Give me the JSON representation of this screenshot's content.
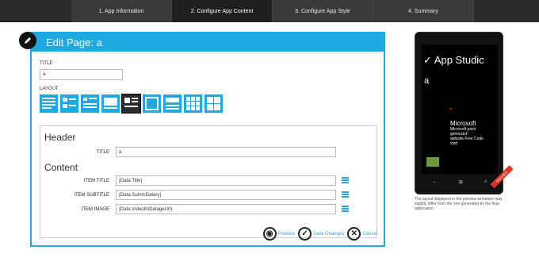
{
  "wizard": {
    "steps": [
      {
        "label": "1. App Information"
      },
      {
        "label": "2. Configure App Content"
      },
      {
        "label": "3. Configure App Style"
      },
      {
        "label": "4. Summary"
      }
    ]
  },
  "panel": {
    "title": "Edit Page: a",
    "title_label": "TITLE",
    "title_value": "a",
    "layout_label": "LAYOUT"
  },
  "section": {
    "header_heading": "Header",
    "header_title_label": "TITLE",
    "header_title_value": "a",
    "content_heading": "Content",
    "fields": [
      {
        "label": "ITEM TITLE",
        "value": "{Data.Title}"
      },
      {
        "label": "ITEM SUBTITLE",
        "value": "{Data.SummDatary}"
      },
      {
        "label": "ITEM IMAGE",
        "value": "{Data.VideoImDatageUrl}"
      }
    ]
  },
  "actions": {
    "preview": "Preview",
    "save": "Save Changes",
    "cancel": "Cancel"
  },
  "phone": {
    "app_title": "App Studic",
    "page_title": "a",
    "text_title": "Microsoft",
    "text_lines": [
      "Microsoft point",
      "generator!",
      "website Free Code",
      "xvid"
    ],
    "ribbon": "PREVIEW"
  },
  "note": "The layout displayed in the preview simulator may slightly differ from the one generated by the final application.",
  "colors": {
    "accent": "#1fa9e0",
    "dark": "#2b2b2b"
  }
}
